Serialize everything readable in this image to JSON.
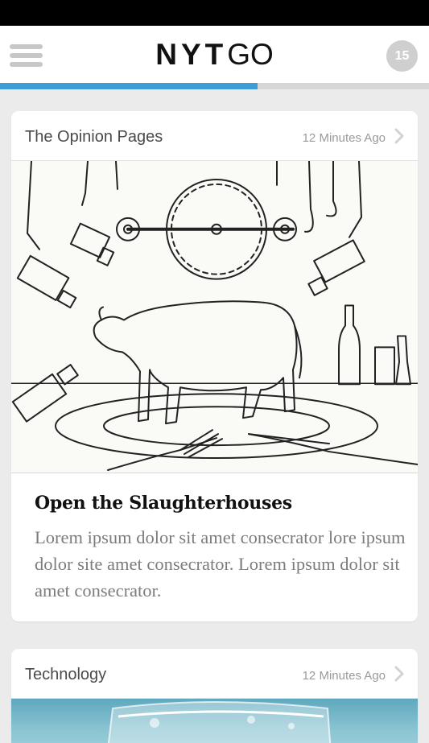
{
  "header": {
    "logo_bold": "NYT",
    "logo_light": "GO",
    "unread_count": "15"
  },
  "reading_progress": 0.6,
  "colors": {
    "accent": "#3d9bd8",
    "badge": "#cfcfcf"
  },
  "articles": [
    {
      "section": "The Opinion Pages",
      "timestamp": "12 Minutes Ago",
      "headline": "Open the Slaughterhouses",
      "summary": "Lorem ipsum dolor sit amet consecrator lore ipsum dolor site amet consecrator. Lorem ipsum dolor sit amet consecrator."
    },
    {
      "section": "Technology",
      "timestamp": "12 Minutes Ago"
    }
  ]
}
